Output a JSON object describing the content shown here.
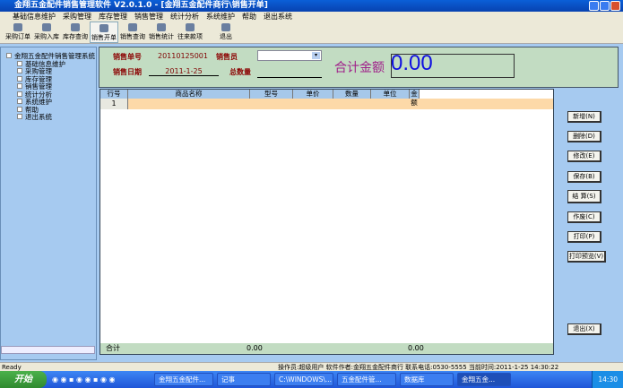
{
  "window": {
    "title": "金翔五金配件销售管理软件  V2.0.1.0 - [金翔五金配件商行\\销售开单]"
  },
  "menu": [
    "基础信息维护",
    "采购管理",
    "库存管理",
    "销售管理",
    "统计分析",
    "系统维护",
    "帮助",
    "退出系统"
  ],
  "toolbar": [
    "采购订单",
    "采购入库",
    "库存查询",
    "销售开单",
    "销售查询",
    "销售统计",
    "往来款项",
    "退出"
  ],
  "tree": {
    "root": "金翔五金配件销售管理系统",
    "children": [
      "基础信息维护",
      "采购管理",
      "库存管理",
      "销售管理",
      "统计分析",
      "系统维护",
      "帮助",
      "退出系统"
    ]
  },
  "form": {
    "order_no_label": "销售单号",
    "order_no": "20110125001",
    "salesman_label": "销售员",
    "salesman": "",
    "date_label": "销售日期",
    "date": "2011-1-25",
    "qty_label": "总数量",
    "qty": "",
    "total_label": "合计金额",
    "total": "0.00"
  },
  "grid": {
    "headers": [
      "行号",
      "商品名称",
      "型号",
      "单价",
      "数量",
      "单位",
      "金额"
    ],
    "rows": [
      [
        "1",
        "",
        "",
        "",
        "",
        "",
        ""
      ]
    ],
    "footer_label": "合计",
    "footer_qty": "0.00",
    "footer_amount": "0.00"
  },
  "buttons": [
    "新增(N)",
    "删除(D)",
    "修改(E)",
    "保存(B)",
    "结 算(S)",
    "作废(C)",
    "打印(P)",
    "打印预览(V)",
    "退出(X)"
  ],
  "status": {
    "ready": "Ready",
    "info": "操作员:超级用户  软件作者:金翔五金配件商行  联系电话:0530-5555  当前时间:2011-1-25 14:30:22"
  },
  "taskbar": {
    "start": "开始",
    "tasks": [
      "金翔五金配件...",
      "记事",
      "C:\\WINDOWS\\...",
      "五金配件管...",
      "数据库",
      "金翔五金..."
    ],
    "clock": "14:30"
  }
}
